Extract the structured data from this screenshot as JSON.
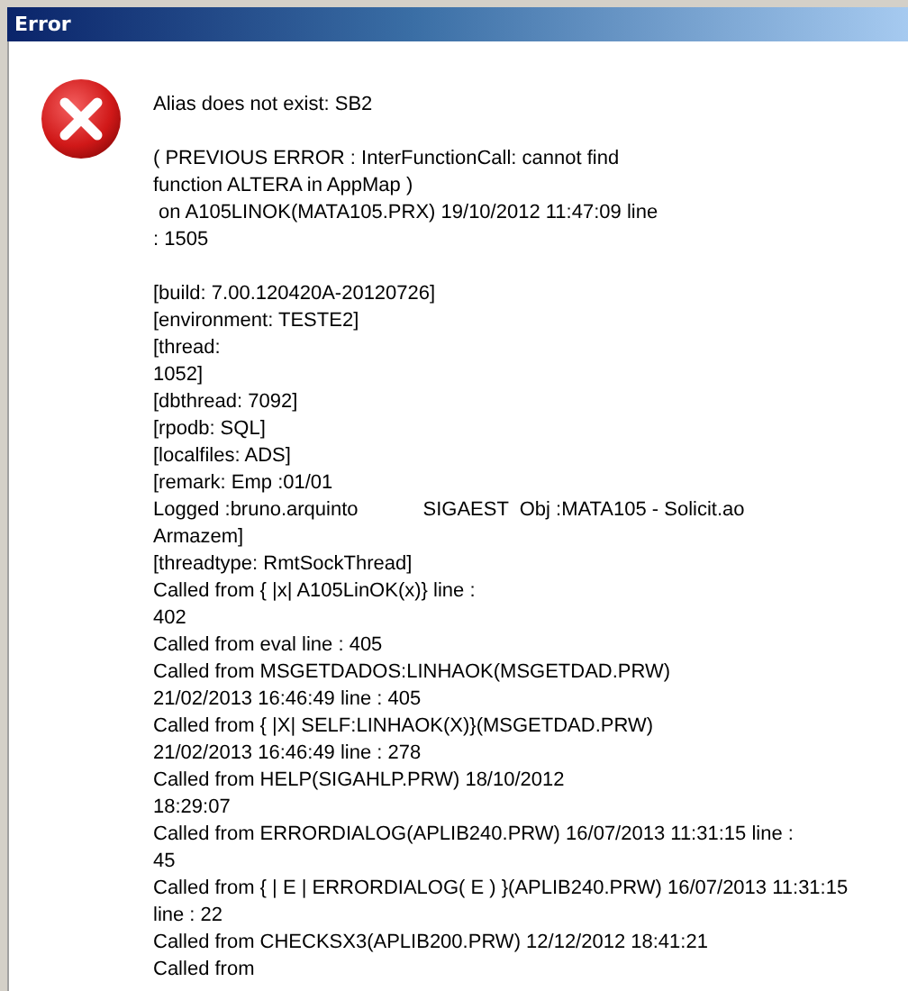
{
  "window": {
    "title": "Error"
  },
  "message_blocks": [
    {
      "lines": [
        [
          "Alias does not exist: SB2"
        ]
      ]
    },
    {
      "lines": [
        [
          "( PREVIOUS ERROR : InterFunctionCall: cannot find"
        ],
        [
          "function ALTERA in AppMap )"
        ],
        [
          " on A105LINOK(MATA105.PRX) 19/10/2012 11:47:09 line"
        ],
        [
          ": 1505"
        ]
      ]
    },
    {
      "lines": [
        [
          "[build: 7.00.120420A-20120726]"
        ],
        [
          "[environment: TESTE2]"
        ],
        [
          "[thread:"
        ],
        [
          "1052]"
        ],
        [
          "[dbthread: 7092]"
        ],
        [
          "[rpodb: SQL]"
        ],
        [
          "[localfiles: ADS]"
        ],
        [
          "[remark: Emp :01/01"
        ],
        [
          "Logged :bruno.arquinto",
          "SIGAEST  Obj :MATA105 - Solicit.ao"
        ],
        [
          "Armazem]"
        ],
        [
          "[threadtype: RmtSockThread]"
        ],
        [
          "Called from { |x| A105LinOK(x)} line :"
        ],
        [
          "402"
        ],
        [
          "Called from eval line : 405"
        ],
        [
          "Called from MSGETDADOS:LINHAOK(MSGETDAD.PRW)"
        ],
        [
          "21/02/2013 16:46:49 line : 405"
        ],
        [
          "Called from { |X| SELF:LINHAOK(X)}(MSGETDAD.PRW)"
        ],
        [
          "21/02/2013 16:46:49 line : 278"
        ],
        [
          "Called from HELP(SIGAHLP.PRW) 18/10/2012"
        ],
        [
          "18:29:07"
        ],
        [
          "Called from ERRORDIALOG(APLIB240.PRW) 16/07/2013 11:31:15 line :"
        ],
        [
          "45"
        ],
        [
          "Called from { | E | ERRORDIALOG( E ) }(APLIB240.PRW) 16/07/2013 11:31:15"
        ],
        [
          "line : 22"
        ],
        [
          "Called from CHECKSX3(APLIB200.PRW) 12/12/2012 18:41:21"
        ],
        [
          "Called from"
        ]
      ]
    }
  ]
}
